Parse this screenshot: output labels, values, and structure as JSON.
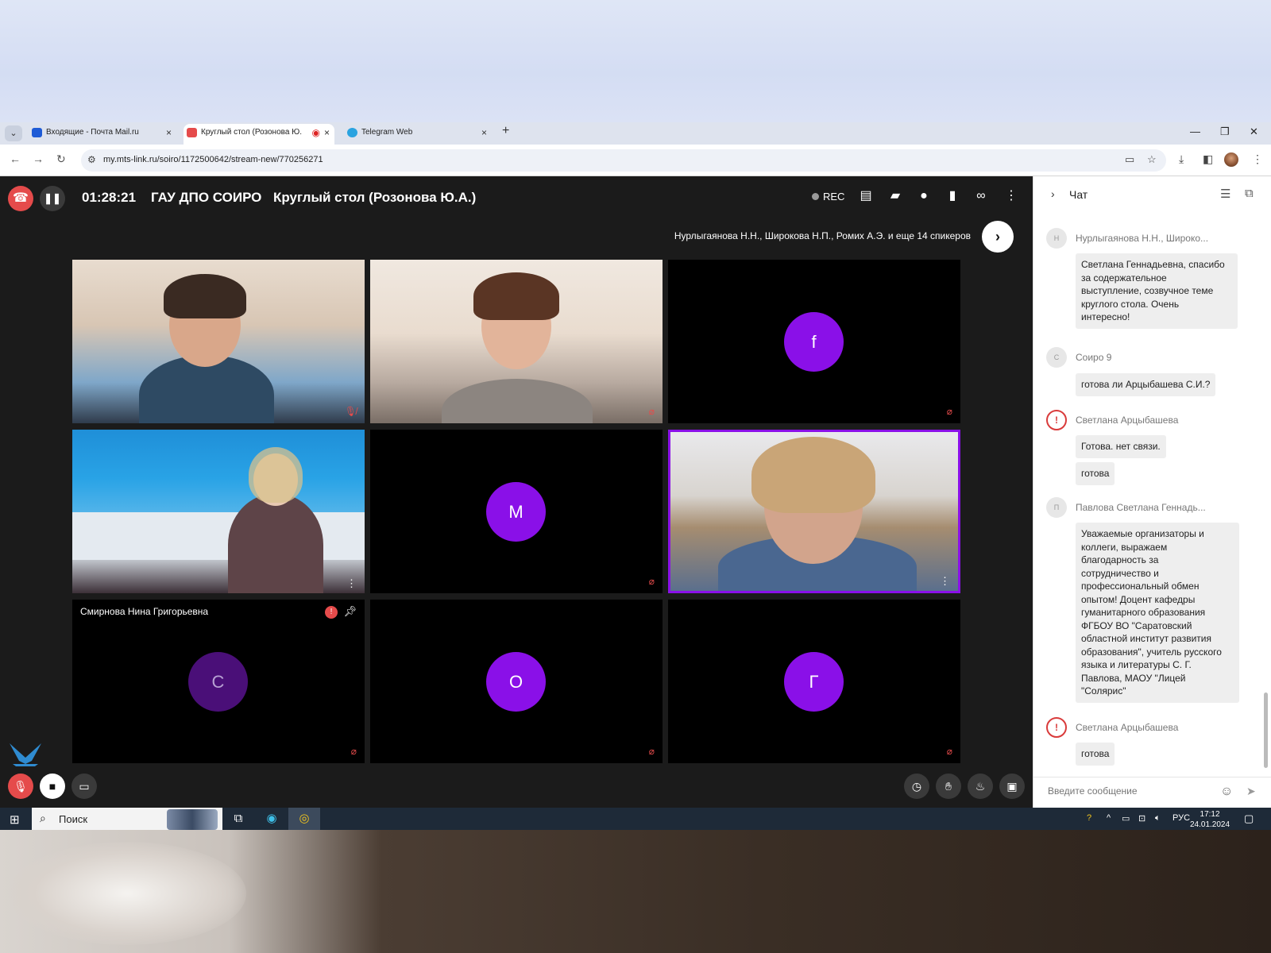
{
  "browser": {
    "tabs": [
      {
        "label": "Входящие - Почта Mail.ru",
        "active": false
      },
      {
        "label": "Круглый стол (Розонова Ю.",
        "active": true
      },
      {
        "label": "Telegram Web",
        "active": false
      }
    ],
    "url": "my.mts-link.ru/soiro/1172500642/stream-new/770256271"
  },
  "webinar": {
    "timer": "01:28:21",
    "organization": "ГАУ ДПО СОИРО",
    "event_title": "Круглый стол (Розонова Ю.А.)",
    "rec_label": "REC",
    "speakers_summary": "Нурлыгаянова Н.Н., Широкова Н.П., Ромих А.Э. и еще 14 спикеров",
    "tiles": [
      {
        "type": "video"
      },
      {
        "type": "video"
      },
      {
        "type": "avatar",
        "initial": "f"
      },
      {
        "type": "video"
      },
      {
        "type": "avatar",
        "initial": "M"
      },
      {
        "type": "video",
        "active_speaker": true
      },
      {
        "type": "avatar",
        "initial": "С",
        "name": "Смирнова Нина Григорьевна"
      },
      {
        "type": "avatar",
        "initial": "О"
      },
      {
        "type": "avatar",
        "initial": "Г"
      }
    ],
    "accent_color": "#8a10e8",
    "danger_color": "#e54b4b"
  },
  "chat": {
    "title": "Чат",
    "messages": [
      {
        "initial": "Н",
        "author": "Нурлыгаянова Н.Н., Широко...",
        "lines": [
          "Светлана Геннадьевна, спасибо",
          "за содержательное",
          "выступление, созвучное теме",
          "круглого стола. Очень",
          "интересно!"
        ]
      },
      {
        "initial": "С",
        "author": "Соиро 9",
        "lines": [
          "готова ли Арцыбашева С.И.?"
        ]
      },
      {
        "initial": "!",
        "author": "Светлана Арцыбашева",
        "bubbles": [
          "Готова. нет связи.",
          "готова"
        ]
      },
      {
        "initial": "П",
        "author": "Павлова Светлана Геннадь...",
        "lines": [
          "Уважаемые организаторы и",
          "коллеги, выражаем",
          "благодарность за",
          "сотрудничество и",
          "профессиональный обмен",
          "опытом! Доцент кафедры",
          "гуманитарного образования",
          "ФГБОУ ВО \"Саратовский",
          "областной институт развития",
          "образования\", учитель русского",
          "языка и литературы С. Г.",
          "Павлова, МАОУ \"Лицей",
          "\"Солярис\""
        ]
      },
      {
        "initial": "!",
        "author": "Светлана Арцыбашева",
        "bubbles": [
          "готова"
        ]
      }
    ],
    "input_placeholder": "Введите сообщение"
  },
  "taskbar": {
    "search_label": "Поиск",
    "language": "РУС",
    "time": "17:12",
    "date": "24.01.2024"
  }
}
